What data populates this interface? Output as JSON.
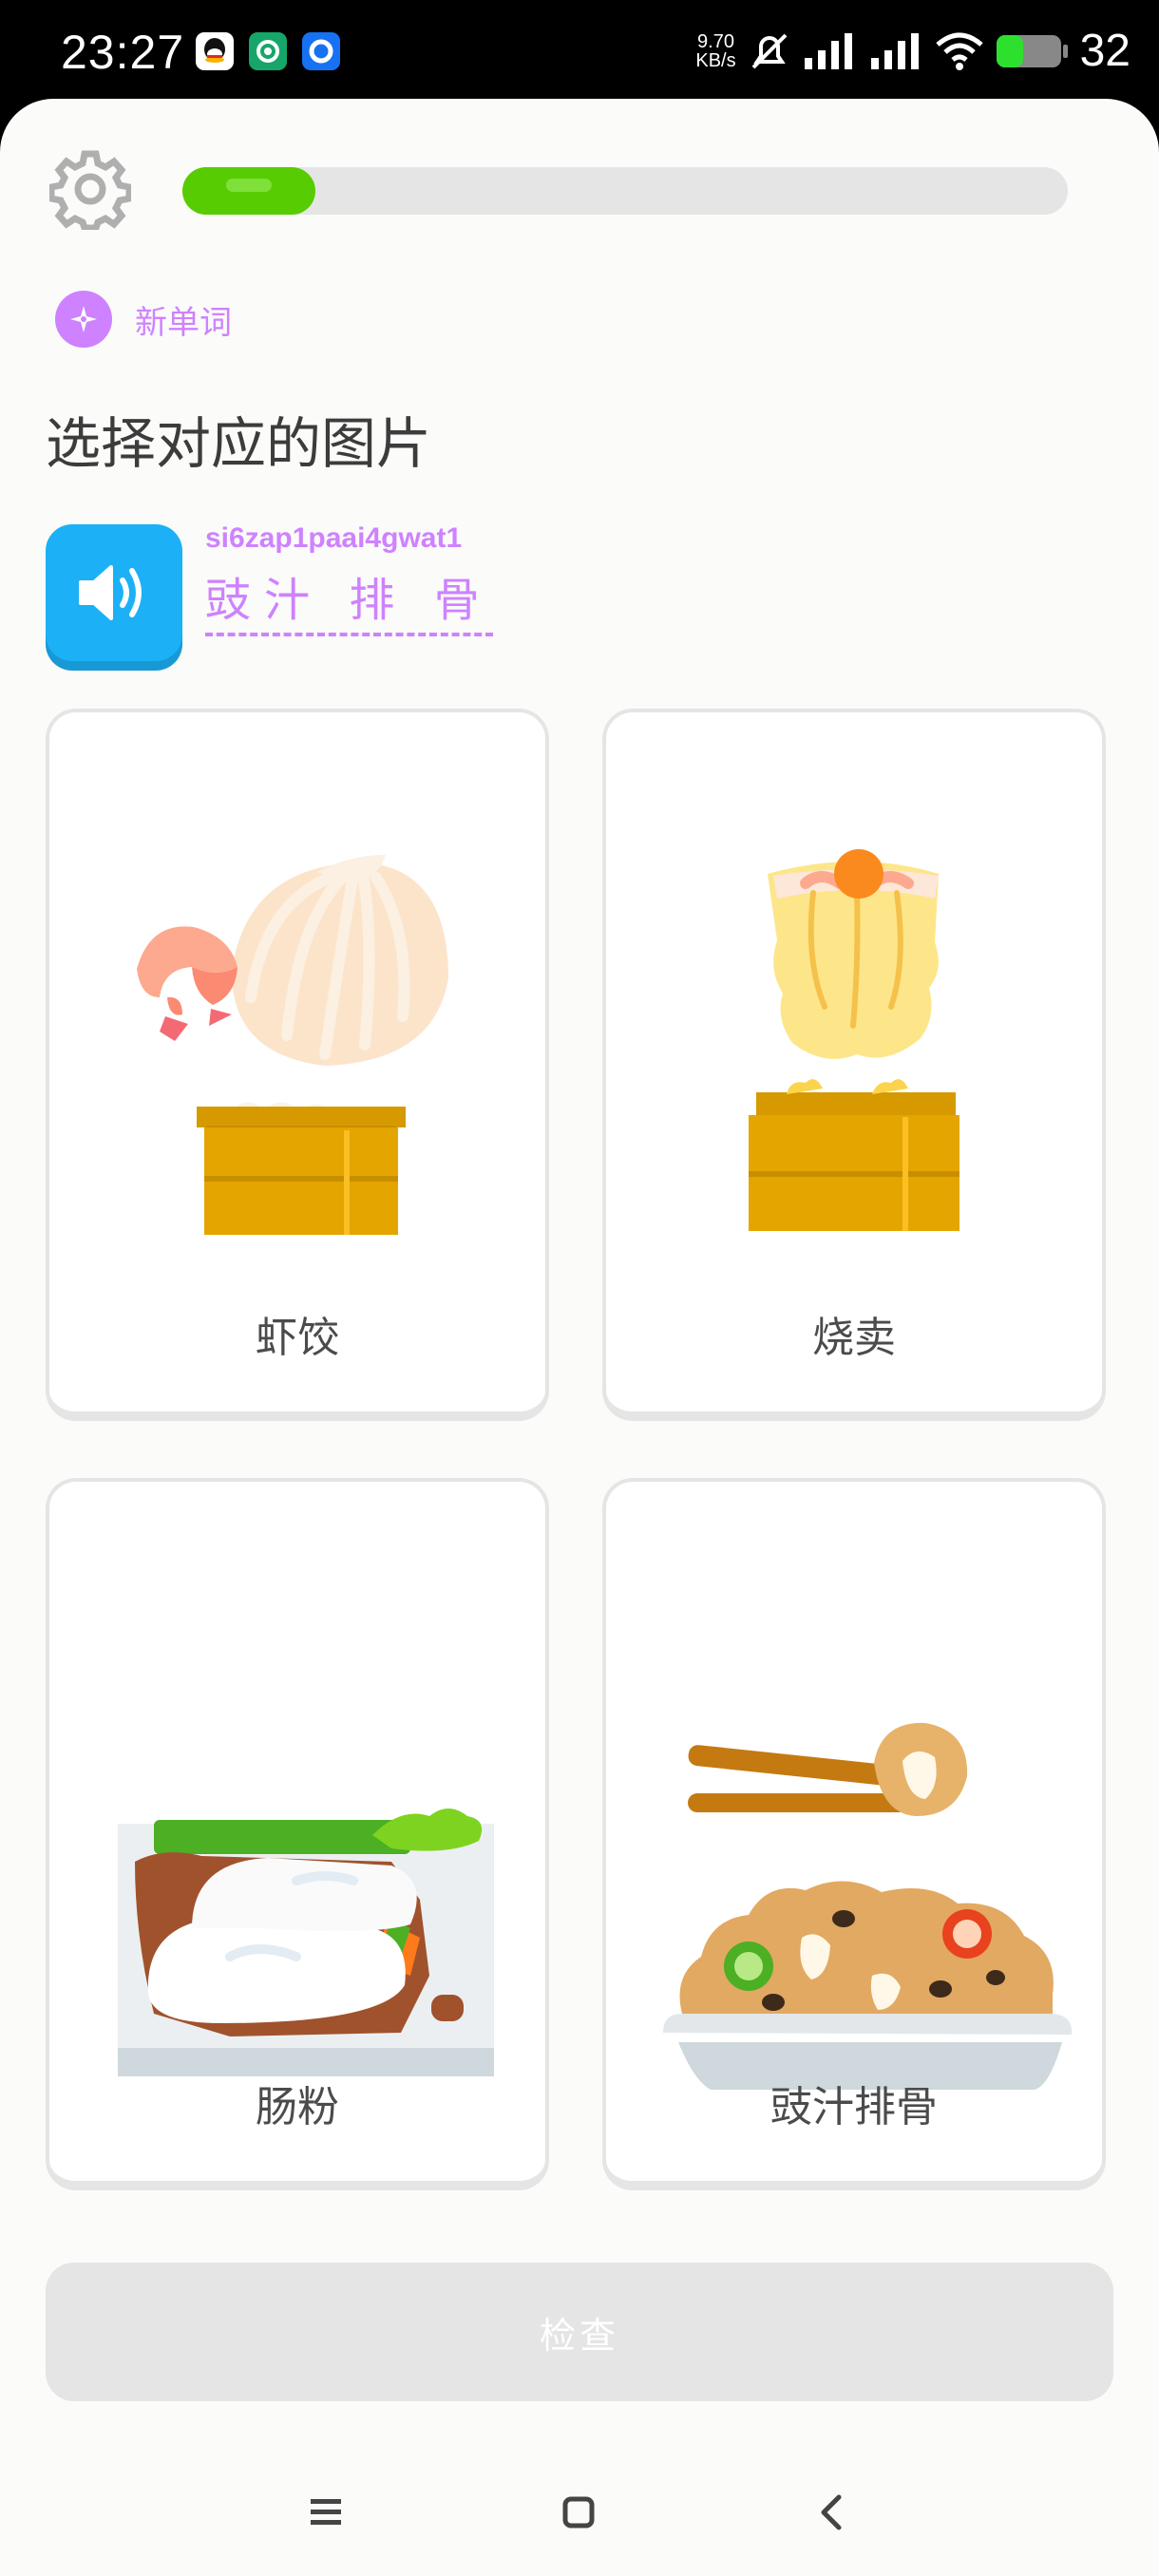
{
  "status": {
    "time": "23:27",
    "speed_value": "9.70",
    "speed_unit": "KB/s",
    "battery": "32"
  },
  "lesson": {
    "progress": 0.15,
    "badge_label": "新单词",
    "title": "选择对应的图片",
    "romanization": "si6zap1paai4gwat1",
    "prompt_words": [
      "豉汁",
      "排",
      "骨"
    ]
  },
  "choices": [
    {
      "label": "虾饺",
      "icon": "har-gow-dumpling-steamer"
    },
    {
      "label": "烧卖",
      "icon": "siu-mai-steamer"
    },
    {
      "label": "肠粉",
      "icon": "cheung-fun-rice-roll"
    },
    {
      "label": "豉汁排骨",
      "icon": "black-bean-spare-ribs"
    }
  ],
  "check_label": "检查",
  "colors": {
    "progress": "#58cc02",
    "accent": "#ce82ff",
    "speaker": "#1cb0f6",
    "disabled": "#e5e5e5"
  }
}
